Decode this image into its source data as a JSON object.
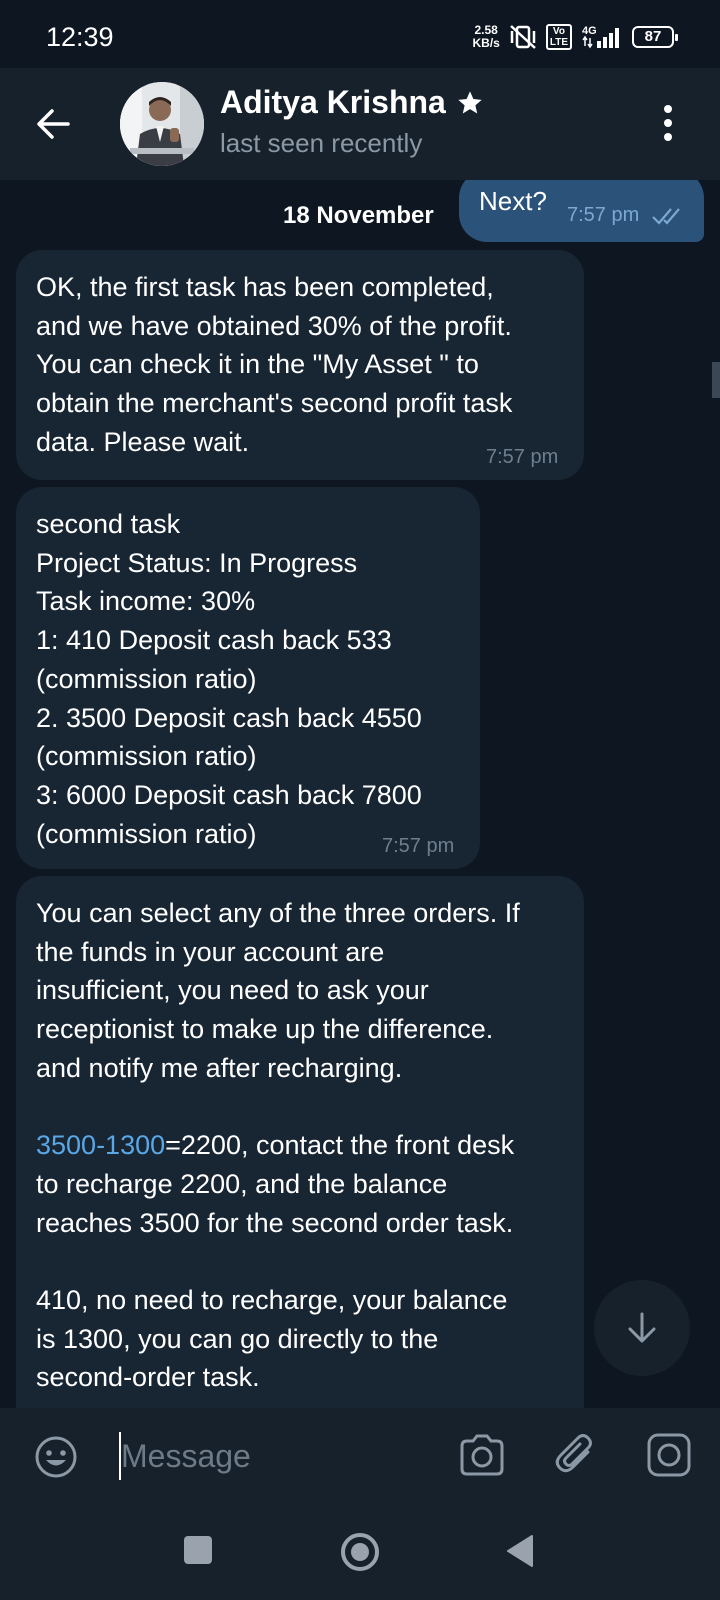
{
  "status_bar": {
    "time": "12:39",
    "net_speed_value": "2.58",
    "net_speed_unit": "KB/s",
    "volte": "Vo LTE",
    "network": "4G",
    "battery": "87"
  },
  "header": {
    "contact_name": "Aditya Krishna",
    "contact_status": "last seen recently"
  },
  "chat": {
    "date_label": "18 November",
    "outgoing": {
      "text": "Next?",
      "time": "7:57 pm"
    },
    "messages": [
      {
        "text": "OK, the first task has been completed,\nand we have obtained 30% of the profit.\nYou can check it in the \"My Asset \" to\nobtain the merchant's second profit task\ndata. Please wait.",
        "time": "7:57 pm"
      },
      {
        "text": "second task\nProject Status: In Progress\nTask income: 30%\n1: 410  Deposit cash back 533\n(commission ratio)\n2. 3500 Deposit cash back 4550\n(commission ratio)\n3: 6000 Deposit cash back 7800\n(commission ratio)",
        "time": "7:57 pm"
      },
      {
        "para1": "You can select any of the three orders. If\nthe funds in your account are\ninsufficient, you need to ask your\nreceptionist to make up the difference.\nand notify me after recharging.",
        "link": "3500-1300",
        "para2_rest": "=2200, contact the front desk",
        "para2_cont": "to recharge 2200, and the balance\nreaches 3500 for the second order task.",
        "para3": "410, no need to recharge, your balance\nis 1300, you can go directly to the\nsecond-order task."
      }
    ]
  },
  "input": {
    "placeholder": "Message"
  },
  "colors": {
    "background": "#0e1621",
    "header": "#17212b",
    "bubble_in": "#182533",
    "bubble_out": "#2b5278",
    "link": "#5aa7e6"
  },
  "icons": {
    "back": "arrow-left-icon",
    "menu": "more-vertical-icon",
    "star": "star-icon",
    "emoji": "emoji-icon",
    "camera": "camera-icon",
    "attach": "paperclip-icon",
    "video": "video-message-icon",
    "scroll": "arrow-down-icon"
  }
}
